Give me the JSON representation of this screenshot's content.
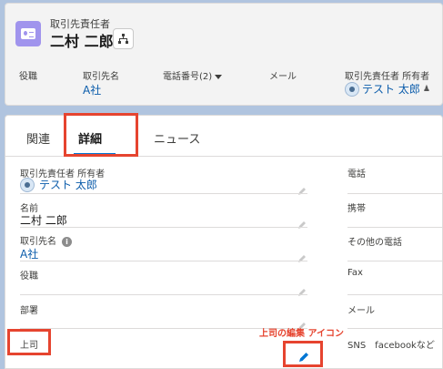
{
  "header": {
    "object_label": "取引先責任者",
    "record_name": "二村 二郎",
    "fields": [
      {
        "label": "役職",
        "value": ""
      },
      {
        "label": "取引先名",
        "value": "A社"
      },
      {
        "label": "電話番号(2)",
        "value": ""
      },
      {
        "label": "メール",
        "value": ""
      },
      {
        "label": "取引先責任者 所有者",
        "value": "テスト 太郎"
      }
    ]
  },
  "tabs": [
    {
      "label": "関連"
    },
    {
      "label": "詳細"
    },
    {
      "label": "ニュース"
    }
  ],
  "left_fields": [
    {
      "label": "取引先責任者 所有者",
      "value": "テスト 太郎"
    },
    {
      "label": "名前",
      "value": "二村 二郎"
    },
    {
      "label": "取引先名",
      "value": "A社"
    },
    {
      "label": "役職",
      "value": ""
    },
    {
      "label": "部署",
      "value": ""
    },
    {
      "label": "上司",
      "value": ""
    }
  ],
  "right_fields": [
    {
      "label": "電話",
      "value": ""
    },
    {
      "label": "携帯",
      "value": ""
    },
    {
      "label": "その他の電話",
      "value": ""
    },
    {
      "label": "Fax",
      "value": ""
    },
    {
      "label": "メール",
      "value": ""
    },
    {
      "label": "SNS　facebookなど",
      "value": ""
    }
  ],
  "annotation": "上司の編集 アイコン",
  "colors": {
    "accent": "#0176d3",
    "highlight": "#e6442f",
    "link": "#0b5cab",
    "record_icon": "#a094ed"
  },
  "icons": {
    "record": "contact-card-icon",
    "hierarchy": "hierarchy-icon",
    "edit": "pencil-icon",
    "info": "info-icon"
  }
}
